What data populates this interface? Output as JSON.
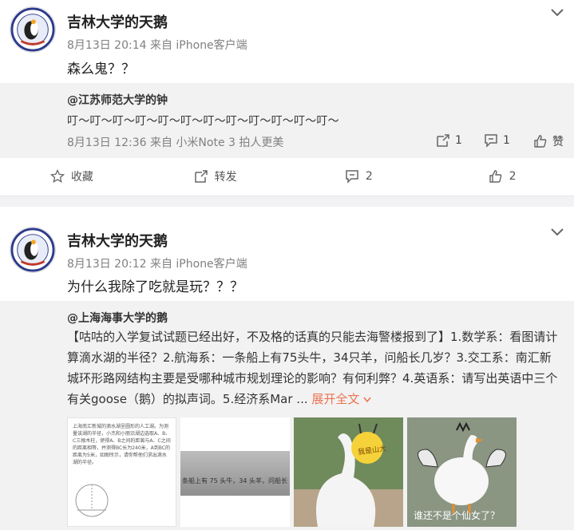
{
  "posts": [
    {
      "author": "吉林大学的天鹅",
      "meta": "8月13日 20:14 来自 iPhone客户端",
      "text": "森么鬼？？",
      "repost": {
        "author": "@江苏师范大学的钟",
        "text": "叮～叮～叮～叮～叮～叮～叮～叮～叮～叮～叮～叮～",
        "meta": "8月13日 12:36 来自 小米Note 3 拍人更美",
        "repost_count": "1",
        "comment_count": "1",
        "like_label": "赞"
      },
      "actions": {
        "collect": "收藏",
        "repost": "转发",
        "comment": "2",
        "like": "2"
      }
    },
    {
      "author": "吉林大学的天鹅",
      "meta": "8月13日 20:12 来自 iPhone客户端",
      "text": "为什么我除了吃就是玩？？？",
      "repost": {
        "author": "@上海海事大学的鹅",
        "text": "【咕咕的入学复试试题已经出好，不及格的话真的只能去海警楼报到了】1.数学系：看图请计算滴水湖的半径？2.航海系：一条船上有75头牛，34只羊，问船长几岁？3.交工系：南汇新城环形路网结构主要是受哪种城市规划理论的影响？有何利弊？4.英语系：请写出英语中三个有关goose（鹅）的拟声词。5.经济系Mar ...",
        "expand": "展开全文",
        "images": [
          {
            "text": "上海南汇新城的滴水湖呈圆形的人工湖。为测量该湖的半径，小杰和小丽沿湖边选取A、B、C三根木柱，使得A、B之间的距离与A、C之间的距离相等，并测得BC长为240米，A到BC的距离为5米，如图所示，请你帮他们求出滴水湖的半径。"
          },
          {
            "text": "条船上有 75 头牛，34 头羊，问船长"
          },
          {
            "text": "我是山大"
          },
          {
            "text": "谁还不是个仙女了？"
          }
        ]
      }
    }
  ],
  "colors": {
    "link": "#eb7350",
    "repost_bg": "#f2f2f2",
    "meta": "#808080"
  },
  "icons": [
    "chevron-down-icon",
    "repost-icon",
    "comment-icon",
    "like-icon",
    "star-icon"
  ]
}
